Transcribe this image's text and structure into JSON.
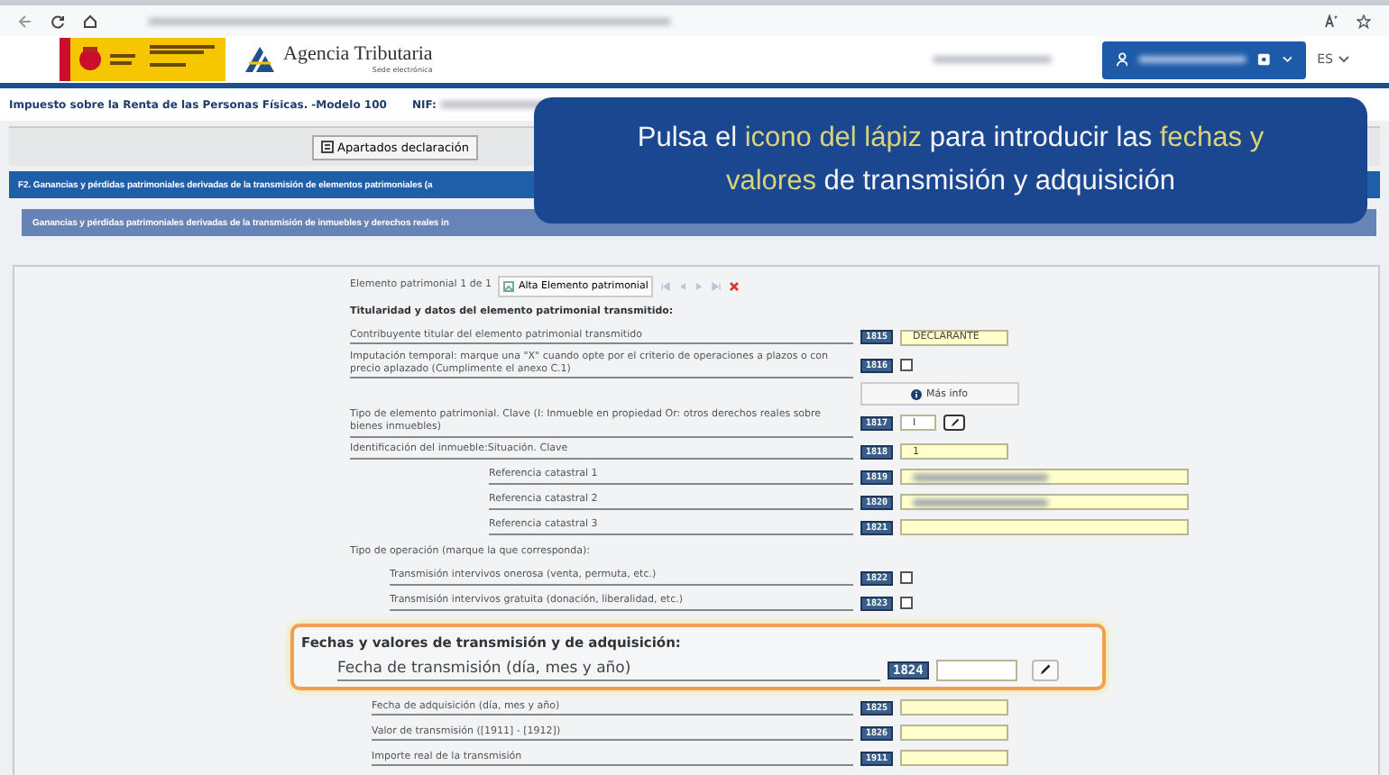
{
  "header": {
    "agency_name": "Agencia Tributaria",
    "agency_subtitle": "Sede electrónica",
    "language": "ES"
  },
  "subheader": {
    "title": "Impuesto sobre la Renta de las Personas Físicas. -Modelo 100",
    "nif_label": "NIF:"
  },
  "toolbar": {
    "button": "Apartados declaración"
  },
  "section_bar": "F2.  Ganancias y pérdidas patrimoniales derivadas de la transmisión de elementos patrimoniales (a",
  "subsection_bar": "Ganancias y pérdidas patrimoniales derivadas de la transmisión de inmuebles y derechos reales in",
  "overlay": {
    "lines": [
      [
        {
          "text": "Pulsa el ",
          "highlight": false
        },
        {
          "text": "icono del lápiz",
          "highlight": true
        },
        {
          "text": " para introducir las ",
          "highlight": false
        },
        {
          "text": "fechas y",
          "highlight": true
        }
      ],
      [
        {
          "text": "valores",
          "highlight": true
        },
        {
          "text": " de transmisión y adquisición",
          "highlight": false
        }
      ]
    ]
  },
  "form": {
    "element_counter": "Elemento patrimonial 1 de 1",
    "add_button": "Alta Elemento patrimonial",
    "rows": [
      {
        "kind": "heading",
        "label": "Titularidad y datos del elemento patrimonial transmitido:",
        "highlighted": false
      },
      {
        "kind": "field",
        "label": "Contribuyente titular del elemento patrimonial transmitido",
        "code": "1815",
        "value": "DECLARANTE",
        "shaded": true,
        "highlighted": false
      },
      {
        "kind": "checkbox",
        "label": "Imputación temporal: marque una \"X\" cuando opte por el criterio de operaciones a plazos o con precio aplazado (Cumplimente el anexo C.1)",
        "code": "1816",
        "checked": false,
        "highlighted": false
      },
      {
        "kind": "info_button",
        "label": "Más info"
      },
      {
        "kind": "edit_field",
        "label": "Tipo de elemento patrimonial. Clave (I: Inmueble en propiedad Or: otros derechos reales sobre bienes inmuebles)",
        "code": "1817",
        "value": "I",
        "shaded": false,
        "highlighted": false
      },
      {
        "kind": "field",
        "label": "Identificación del inmueble:Situación. Clave",
        "code": "1818",
        "value": "1",
        "shaded": true,
        "highlighted": false,
        "children": [
          {
            "kind": "field",
            "label": "Referencia catastral 1",
            "code": "1819",
            "redacted": true,
            "shaded": true,
            "wide": true,
            "highlighted": false
          },
          {
            "kind": "field",
            "label": "Referencia catastral 2",
            "code": "1820",
            "redacted": true,
            "shaded": true,
            "wide": true,
            "highlighted": false
          },
          {
            "kind": "field",
            "label": "Referencia catastral 3",
            "code": "1821",
            "shaded": true,
            "wide": true,
            "highlighted": false
          }
        ]
      },
      {
        "kind": "text",
        "label": "Tipo de operación (marque la que corresponda):",
        "highlighted": false,
        "children": [
          {
            "kind": "checkbox",
            "label": "Transmisión intervivos onerosa (venta, permuta, etc.)",
            "code": "1822",
            "checked": false,
            "highlighted": false
          },
          {
            "kind": "checkbox",
            "label": "Transmisión intervivos gratuita (donación, liberalidad, etc.)",
            "code": "1823",
            "checked": false,
            "highlighted": false
          }
        ]
      },
      {
        "kind": "heading",
        "label": "Fechas y valores de transmisión y de adquisición:",
        "highlighted": true,
        "children": [
          {
            "kind": "edit_field",
            "label": "Fecha de transmisión (día, mes y año)",
            "code": "1824",
            "shaded": false,
            "highlighted": true
          },
          {
            "kind": "field",
            "label": "Fecha de adquisición (día, mes y año)",
            "code": "1825",
            "shaded": true,
            "highlighted": false
          },
          {
            "kind": "field",
            "label": "Valor de transmisión ([1911] - [1912])",
            "code": "1826",
            "shaded": true,
            "highlighted": false
          },
          {
            "kind": "field",
            "label": "Importe real de la transmisión",
            "code": "1911",
            "shaded": true,
            "highlighted": false
          }
        ]
      }
    ]
  }
}
